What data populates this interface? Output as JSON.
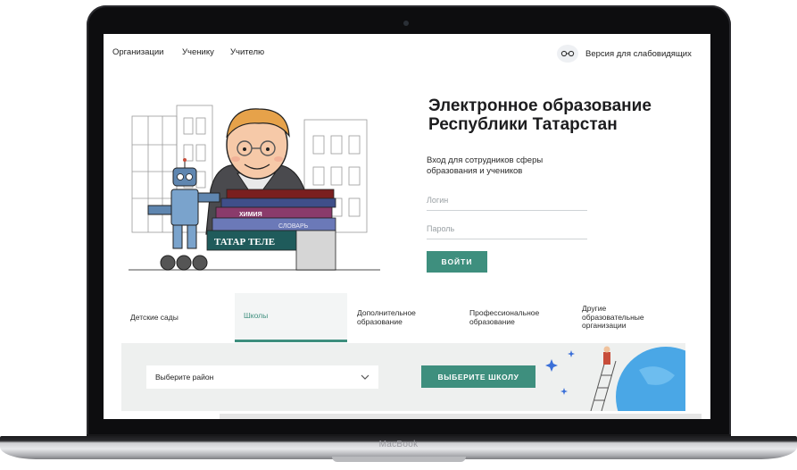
{
  "device": {
    "label": "MacBook"
  },
  "nav": {
    "links": [
      "Организации",
      "Ученику",
      "Учителю"
    ],
    "accessibility_label": "Версия для слабовидящих"
  },
  "hero": {
    "title_line1": "Электронное образование",
    "title_line2": "Республики Татарстан",
    "subtitle_line1": "Вход для сотрудников сферы",
    "subtitle_line2": "образования и учеников",
    "login_placeholder": "Логин",
    "password_placeholder": "Пароль",
    "login_button": "ВОЙТИ"
  },
  "illustration": {
    "books": [
      "ХИМИЯ",
      "СЛОВАРЬ",
      "ТАТАР ТЕЛЕ"
    ]
  },
  "tabs": [
    {
      "line1": "Детские сады",
      "line2": "",
      "line3": ""
    },
    {
      "line1": "Школы",
      "line2": "",
      "line3": ""
    },
    {
      "line1": "Дополнительное",
      "line2": "образование",
      "line3": ""
    },
    {
      "line1": "Профессиональное",
      "line2": "образование",
      "line3": ""
    },
    {
      "line1": "Другие",
      "line2": "образовательные",
      "line3": "организации"
    }
  ],
  "active_tab": "Школы",
  "school_search": {
    "district_select": "Выберите район",
    "choose_button": "ВЫБЕРИТЕ ШКОЛУ"
  },
  "colors": {
    "accent": "#3e8f7e",
    "band": "#eef0ef",
    "globe": "#4aa7e6"
  }
}
